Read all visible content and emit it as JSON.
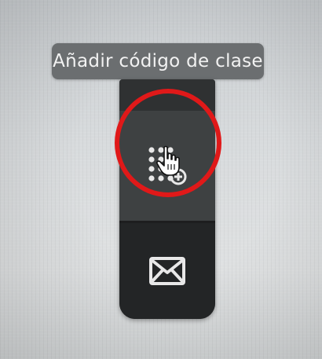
{
  "tooltip": {
    "text": "Añadir código de clase"
  },
  "toolbar": {
    "buttons": [
      {
        "icon": "keypad-icon",
        "state": "hovered"
      },
      {
        "icon": "mail-icon",
        "state": "normal"
      }
    ]
  },
  "annotation": {
    "highlight_color": "#e01919"
  },
  "colors": {
    "tooltip_bg": "#6b6e70",
    "toolbar_bg": "#2a2c2d",
    "hover_bg": "#3e4142",
    "icon_color": "#e8e8e8"
  }
}
